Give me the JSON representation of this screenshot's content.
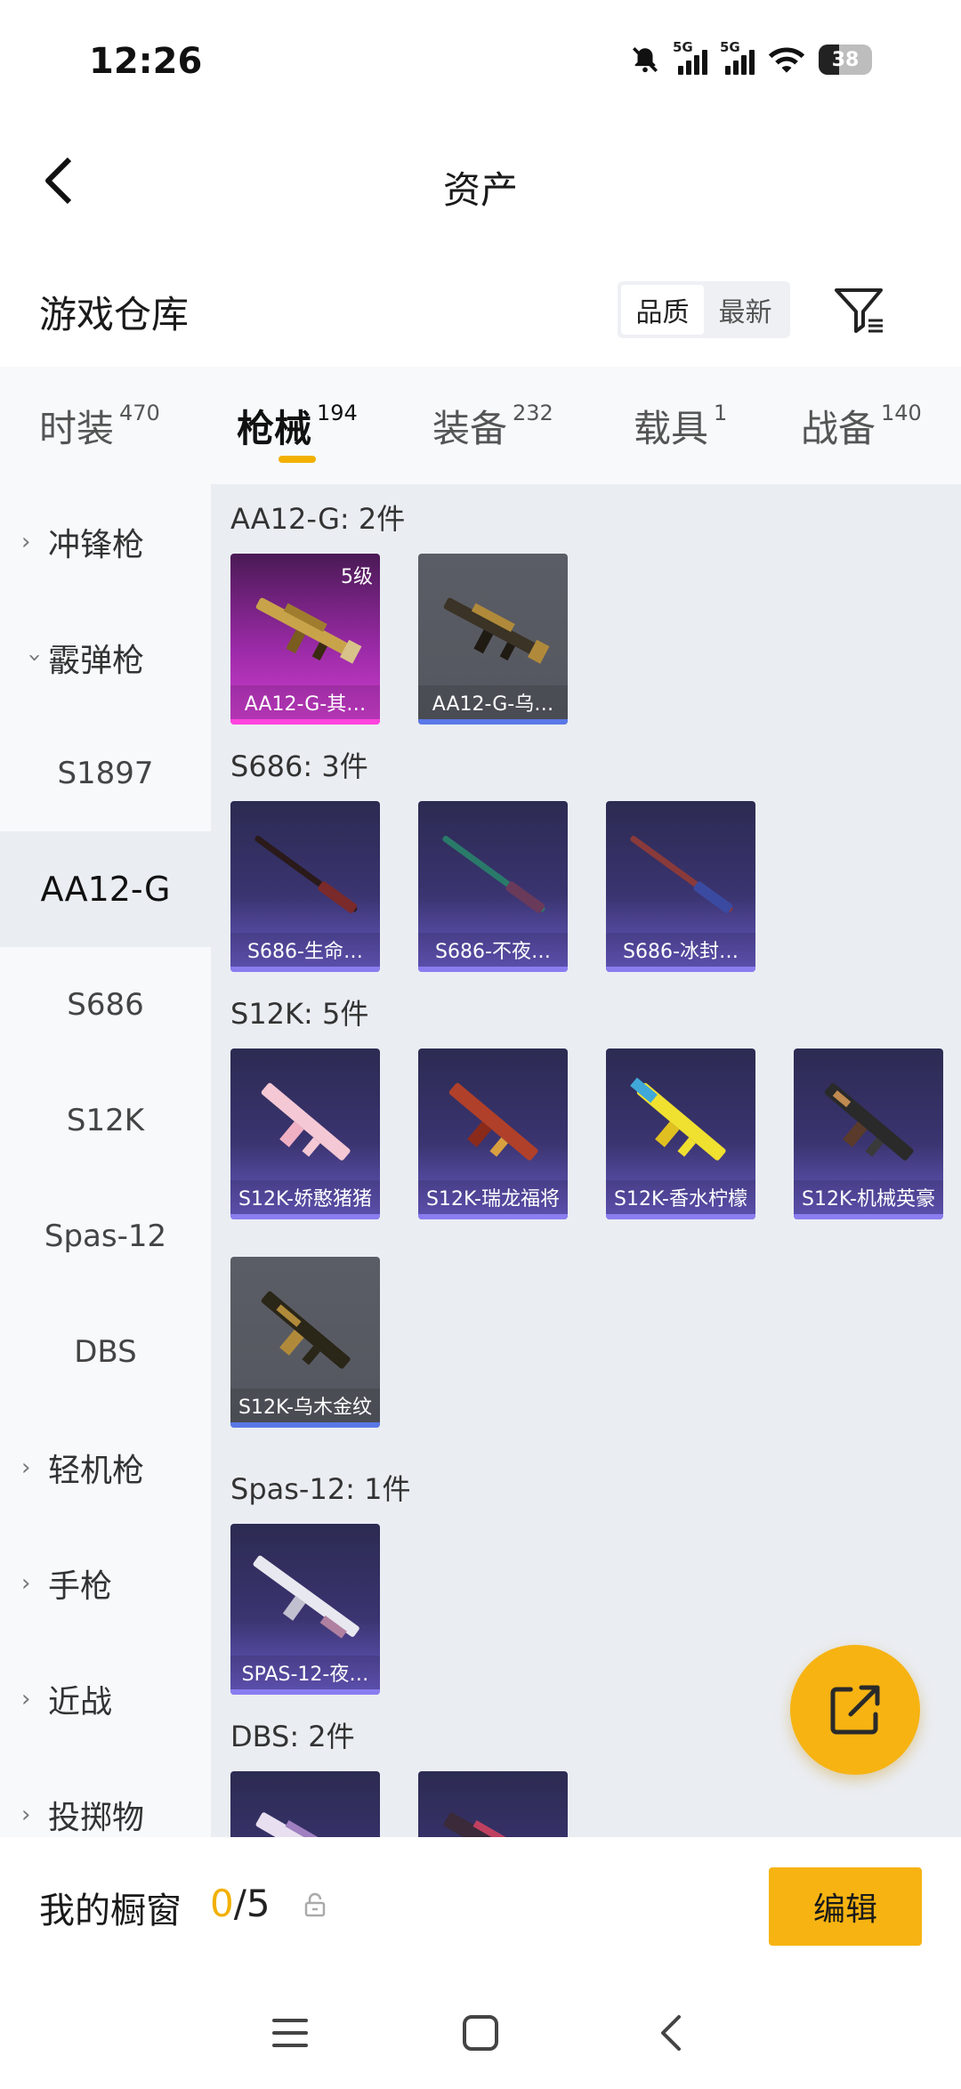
{
  "status_bar": {
    "time": "12:26",
    "battery": "38"
  },
  "header": {
    "title": "资产"
  },
  "warehouse": {
    "title": "游戏仓库",
    "sort_options": [
      "品质",
      "最新"
    ],
    "sort_selected": "品质"
  },
  "tabs": [
    {
      "label": "时装",
      "count": "470"
    },
    {
      "label": "枪械",
      "count": "194"
    },
    {
      "label": "装备",
      "count": "232"
    },
    {
      "label": "载具",
      "count": "1"
    },
    {
      "label": "战备",
      "count": "140"
    }
  ],
  "active_tab": "枪械",
  "categories": [
    {
      "label": "冲锋枪",
      "type": "group",
      "expanded": false
    },
    {
      "label": "霰弹枪",
      "type": "group",
      "expanded": true
    },
    {
      "label": "S1897",
      "type": "sub"
    },
    {
      "label": "AA12-G",
      "type": "sub",
      "active": true
    },
    {
      "label": "S686",
      "type": "sub"
    },
    {
      "label": "S12K",
      "type": "sub"
    },
    {
      "label": "Spas-12",
      "type": "sub"
    },
    {
      "label": "DBS",
      "type": "sub"
    },
    {
      "label": "轻机枪",
      "type": "group",
      "expanded": false
    },
    {
      "label": "手枪",
      "type": "group",
      "expanded": false
    },
    {
      "label": "近战",
      "type": "group",
      "expanded": false
    },
    {
      "label": "投掷物",
      "type": "group",
      "expanded": false
    }
  ],
  "sections": [
    {
      "title": "AA12-G: 2件",
      "items": [
        {
          "name": "AA12-G-其…",
          "style": "magenta",
          "badge": "5级"
        },
        {
          "name": "AA12-G-乌…",
          "style": "gray"
        }
      ]
    },
    {
      "title": "S686: 3件",
      "items": [
        {
          "name": "S686-生命…",
          "style": "purple"
        },
        {
          "name": "S686-不夜…",
          "style": "purple"
        },
        {
          "name": "S686-冰封…",
          "style": "purple"
        }
      ]
    },
    {
      "title": "S12K: 5件",
      "items": [
        {
          "name": "S12K-娇憨猪猪",
          "style": "purple"
        },
        {
          "name": "S12K-瑞龙福将",
          "style": "purple"
        },
        {
          "name": "S12K-香水柠檬",
          "style": "purple"
        },
        {
          "name": "S12K-机械英豪",
          "style": "purple"
        },
        {
          "name": "S12K-乌木金纹",
          "style": "gray"
        }
      ]
    },
    {
      "title": "Spas-12: 1件",
      "items": [
        {
          "name": "SPAS-12-夜…",
          "style": "purple"
        }
      ]
    },
    {
      "title": "DBS: 2件",
      "items": [
        {
          "name": "",
          "style": "purple"
        },
        {
          "name": "",
          "style": "purple"
        }
      ]
    }
  ],
  "showcase": {
    "title": "我的橱窗",
    "current": "0",
    "total": "/5",
    "edit_label": "编辑"
  },
  "colors": {
    "accent": "#f6b312",
    "content_bg": "#eaedf2",
    "sidebar_bg": "#f7f9fb"
  },
  "icons": [
    "back-arrow-icon",
    "filter-icon",
    "share-icon",
    "lock-icon",
    "menu-icon",
    "home-icon",
    "nav-back-icon"
  ]
}
